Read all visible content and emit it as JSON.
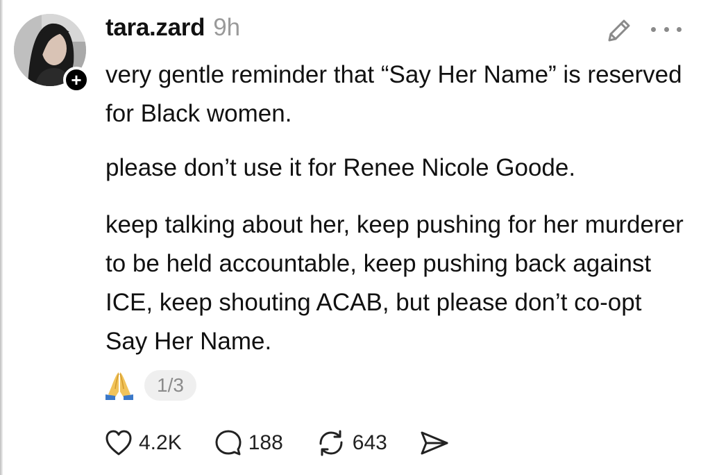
{
  "post": {
    "author": "tara.zard",
    "time_ago": "9h",
    "follow_symbol": "+",
    "paragraphs": [
      "very gentle reminder that “Say Her Name” is reserved for Black women.",
      "please don’t use it for Renee Nicole Goode.",
      "keep talking about her, keep pushing for her murderer to be held accountable, keep pushing back against ICE, keep shouting ACAB, but please don’t co-opt Say Her Name."
    ],
    "emoji": "folded-hands",
    "page_indicator": "1/3"
  },
  "header_icons": {
    "edit": "pencil-icon",
    "more": "more-options-icon"
  },
  "actions": {
    "likes": "4.2K",
    "replies": "188",
    "reposts": "643",
    "like_icon": "heart-icon",
    "reply_icon": "comment-bubble-icon",
    "repost_icon": "repost-icon",
    "share_icon": "send-icon"
  },
  "colors": {
    "text": "#111111",
    "muted": "#9a9a9a",
    "pill_bg": "#efefef",
    "badge": "#000000"
  }
}
